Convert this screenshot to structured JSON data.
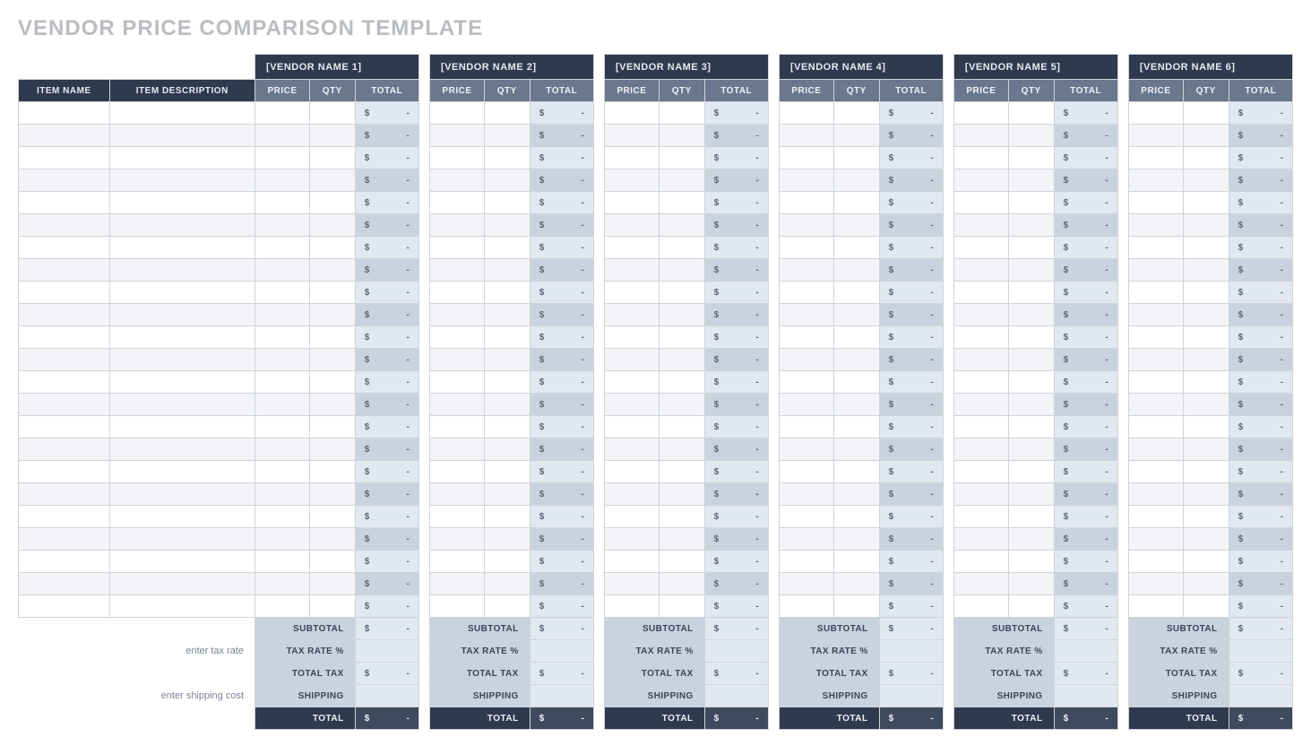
{
  "title": "VENDOR PRICE COMPARISON TEMPLATE",
  "item_headers": {
    "name": "ITEM NAME",
    "description": "ITEM DESCRIPTION"
  },
  "sub_headers": {
    "price": "PRICE",
    "qty": "QTY",
    "total": "TOTAL"
  },
  "vendors": [
    {
      "name": "[VENDOR NAME 1]"
    },
    {
      "name": "[VENDOR NAME 2]"
    },
    {
      "name": "[VENDOR NAME 3]"
    },
    {
      "name": "[VENDOR NAME 4]"
    },
    {
      "name": "[VENDOR NAME 5]"
    },
    {
      "name": "[VENDOR NAME 6]"
    }
  ],
  "row_count": 23,
  "currency_symbol": "$",
  "empty_value": "-",
  "summary": {
    "subtotal_label": "SUBTOTAL",
    "tax_rate_label": "TAX RATE %",
    "total_tax_label": "TOTAL TAX",
    "shipping_label": "SHIPPING",
    "total_label": "TOTAL",
    "tax_hint": "enter tax rate",
    "shipping_hint": "enter shipping cost"
  }
}
